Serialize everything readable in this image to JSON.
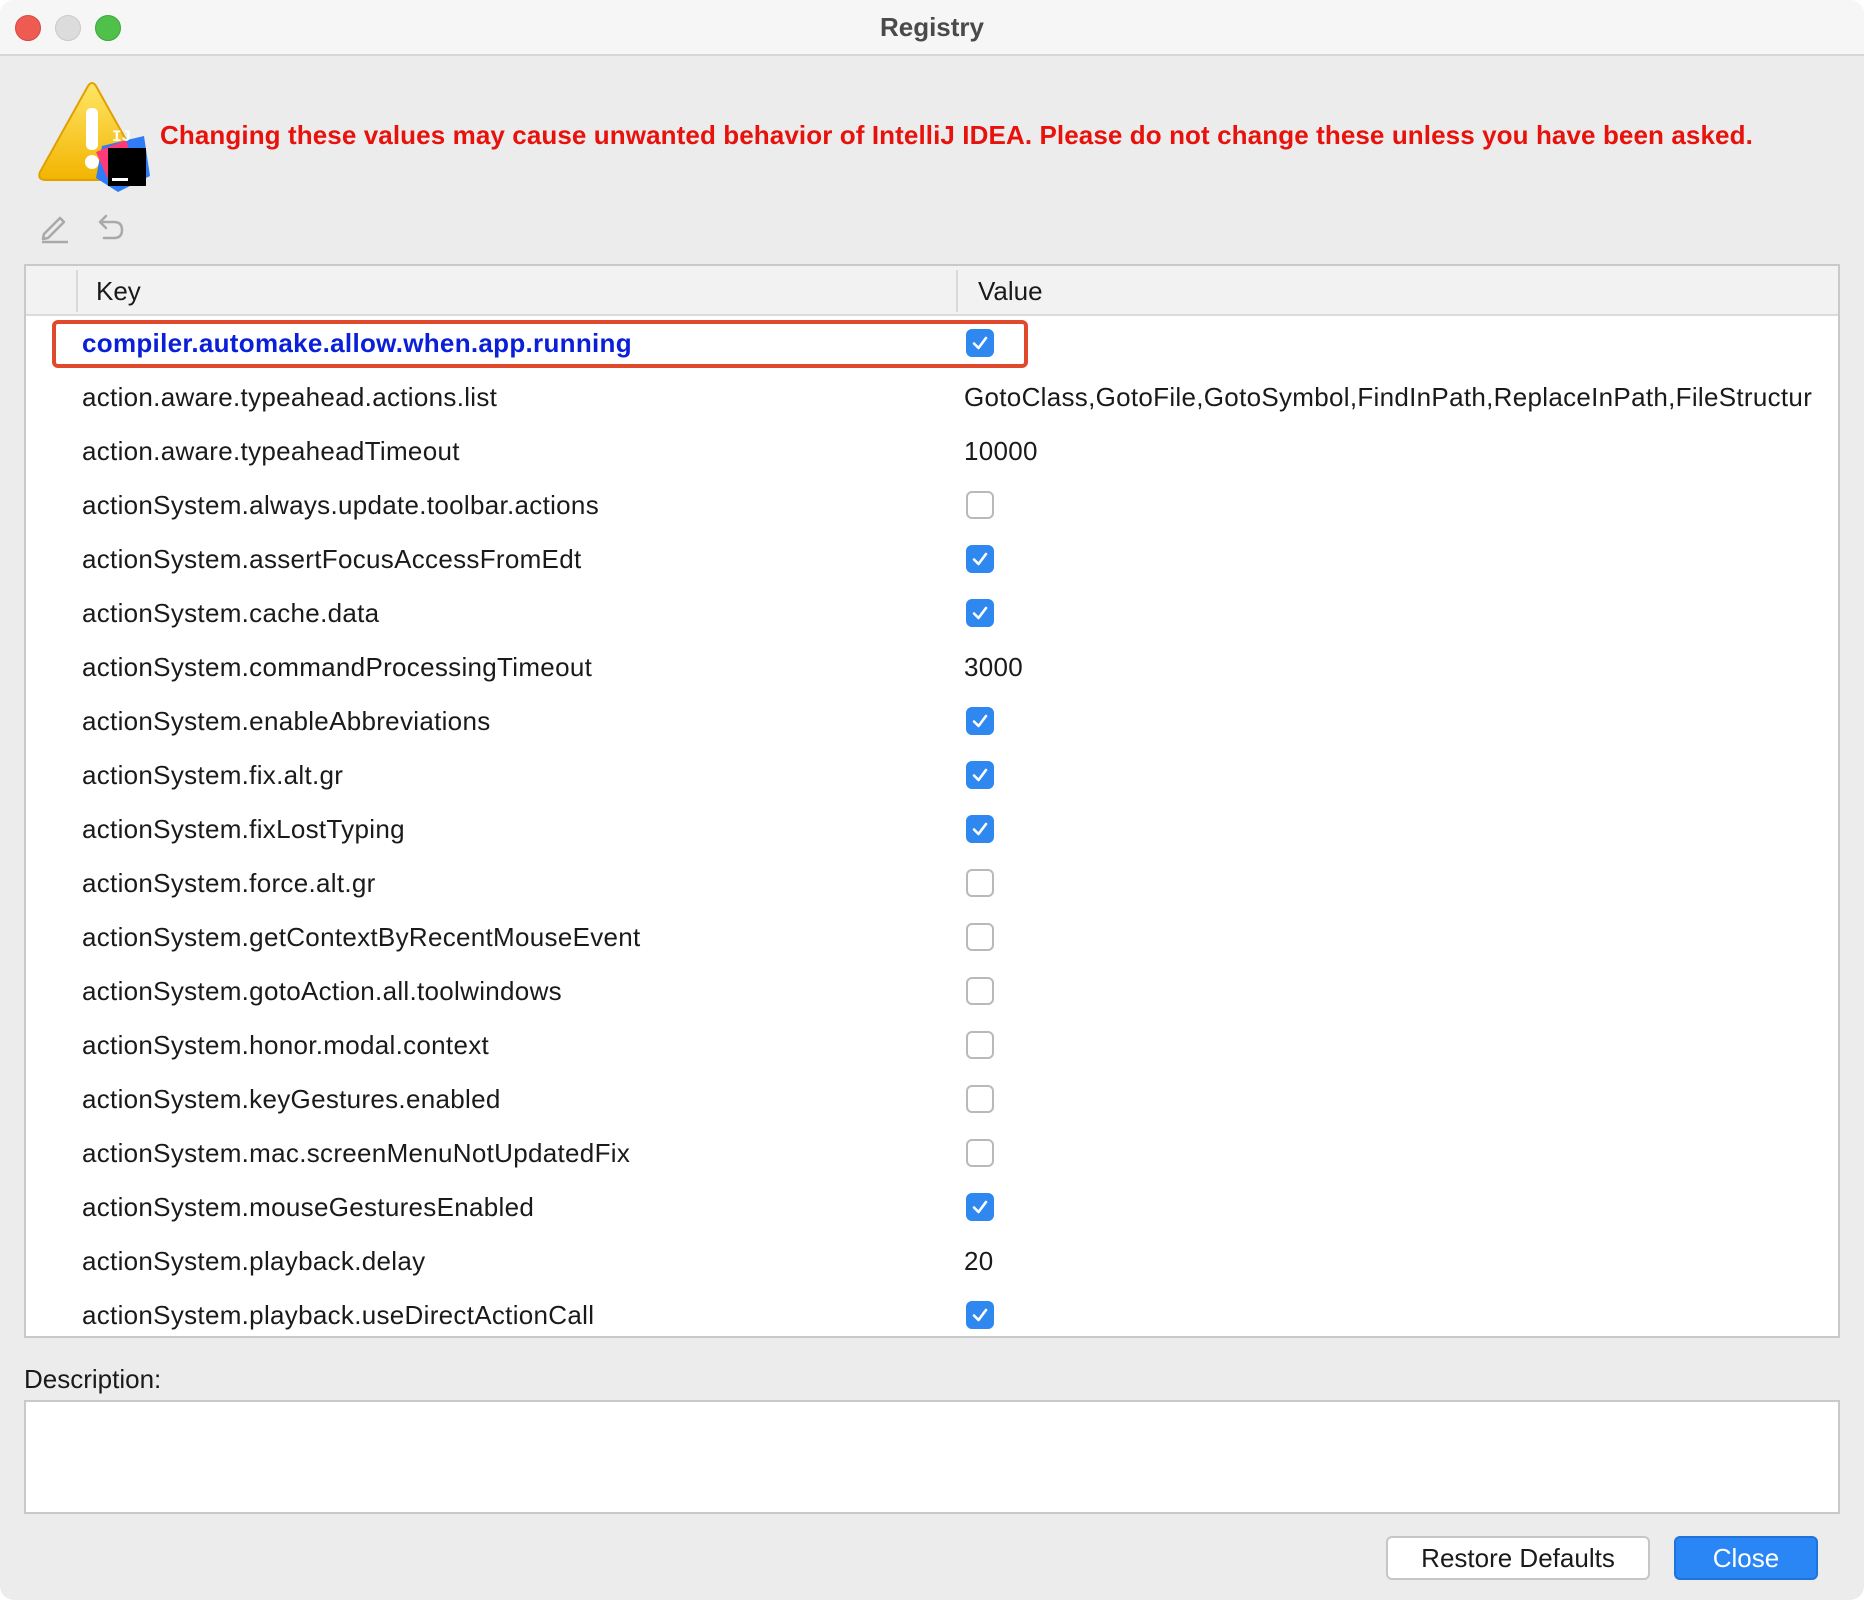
{
  "window": {
    "title": "Registry"
  },
  "warning": {
    "text": "Changing these values may cause unwanted behavior of IntelliJ IDEA. Please do not change these unless you have been asked.",
    "color": "#e8120c",
    "icon": "warning-intellij-icon",
    "badge_text": "IJ"
  },
  "toolbar": {
    "edit_icon": "pencil-icon",
    "revert_icon": "undo-icon"
  },
  "table": {
    "columns": [
      "Key",
      "Value"
    ],
    "rows": [
      {
        "key": "compiler.automake.allow.when.app.running",
        "type": "checkbox",
        "checked": true,
        "changed": true
      },
      {
        "key": "action.aware.typeahead.actions.list",
        "type": "text",
        "value": "GotoClass,GotoFile,GotoSymbol,FindInPath,ReplaceInPath,FileStructur"
      },
      {
        "key": "action.aware.typeaheadTimeout",
        "type": "text",
        "value": "10000"
      },
      {
        "key": "actionSystem.always.update.toolbar.actions",
        "type": "checkbox",
        "checked": false
      },
      {
        "key": "actionSystem.assertFocusAccessFromEdt",
        "type": "checkbox",
        "checked": true
      },
      {
        "key": "actionSystem.cache.data",
        "type": "checkbox",
        "checked": true
      },
      {
        "key": "actionSystem.commandProcessingTimeout",
        "type": "text",
        "value": "3000"
      },
      {
        "key": "actionSystem.enableAbbreviations",
        "type": "checkbox",
        "checked": true
      },
      {
        "key": "actionSystem.fix.alt.gr",
        "type": "checkbox",
        "checked": true
      },
      {
        "key": "actionSystem.fixLostTyping",
        "type": "checkbox",
        "checked": true
      },
      {
        "key": "actionSystem.force.alt.gr",
        "type": "checkbox",
        "checked": false
      },
      {
        "key": "actionSystem.getContextByRecentMouseEvent",
        "type": "checkbox",
        "checked": false
      },
      {
        "key": "actionSystem.gotoAction.all.toolwindows",
        "type": "checkbox",
        "checked": false
      },
      {
        "key": "actionSystem.honor.modal.context",
        "type": "checkbox",
        "checked": false
      },
      {
        "key": "actionSystem.keyGestures.enabled",
        "type": "checkbox",
        "checked": false
      },
      {
        "key": "actionSystem.mac.screenMenuNotUpdatedFix",
        "type": "checkbox",
        "checked": false
      },
      {
        "key": "actionSystem.mouseGesturesEnabled",
        "type": "checkbox",
        "checked": true
      },
      {
        "key": "actionSystem.playback.delay",
        "type": "text",
        "value": "20"
      },
      {
        "key": "actionSystem.playback.useDirectActionCall",
        "type": "checkbox",
        "checked": true
      }
    ]
  },
  "description": {
    "label": "Description:",
    "value": ""
  },
  "buttons": {
    "restore_label": "Restore Defaults",
    "close_label": "Close"
  },
  "colors": {
    "accent": "#2f87f0",
    "changed_key": "#0a20d8",
    "highlight_border": "#e0492c"
  }
}
